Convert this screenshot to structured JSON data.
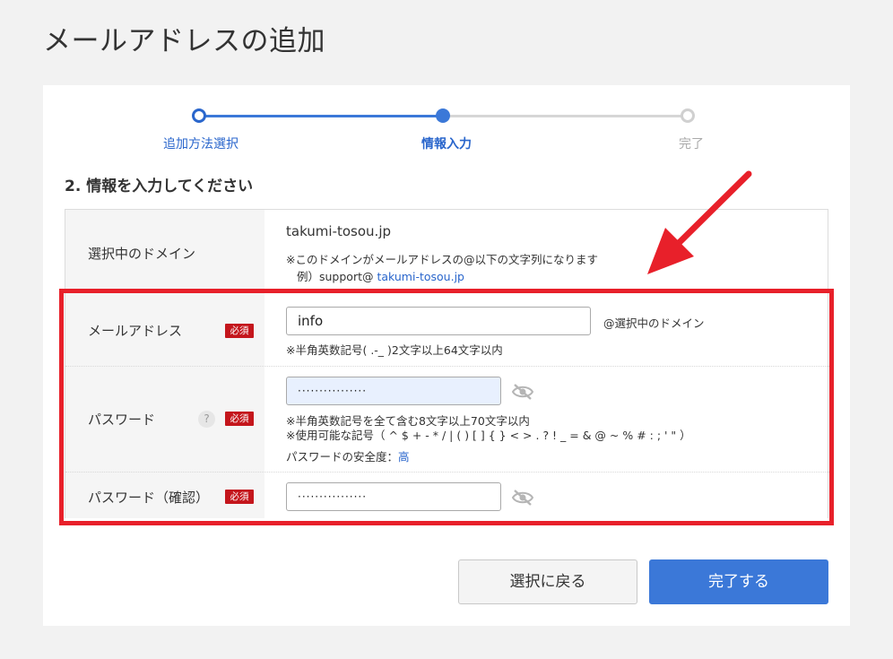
{
  "page_title": "メールアドレスの追加",
  "stepper": {
    "steps": [
      {
        "label": "追加方法選択",
        "state": "done"
      },
      {
        "label": "情報入力",
        "state": "current"
      },
      {
        "label": "完了",
        "state": "todo"
      }
    ]
  },
  "section_title": "2. 情報を入力してください",
  "required_badge": "必須",
  "domain_row": {
    "label": "選択中のドメイン",
    "value": "takumi-tosou.jp",
    "note": "※このドメインがメールアドレスの@以下の文字列になります",
    "example_prefix": "例）support@ ",
    "example_domain": "takumi-tosou.jp"
  },
  "email_row": {
    "label": "メールアドレス",
    "value": "info",
    "suffix": "@選択中のドメイン",
    "hint": "※半角英数記号( .-_ )2文字以上64文字以内"
  },
  "password_row": {
    "label": "パスワード",
    "help": "?",
    "value": "················",
    "hint1": "※半角英数記号を全て含む8文字以上70文字以内",
    "hint2": "※使用可能な記号（ ^ $ + - * / | ( ) [ ] { } < > . ? ! _ = & @ ~ % # : ; ' \" ）",
    "strength_label": "パスワードの安全度：",
    "strength_value": "高"
  },
  "confirm_row": {
    "label": "パスワード（確認）",
    "value": "················"
  },
  "buttons": {
    "back": "選択に戻る",
    "done": "完了する"
  },
  "colors": {
    "accent": "#3b78d8",
    "link": "#2a66cc",
    "required": "#c4161c",
    "annotation": "#e8202a"
  }
}
